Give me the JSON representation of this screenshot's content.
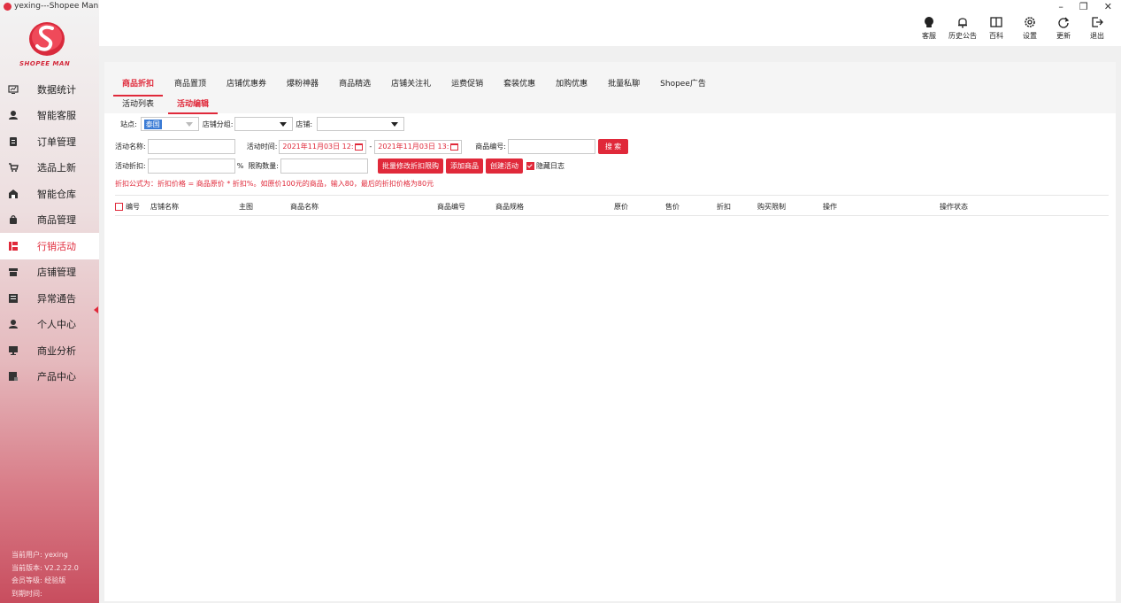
{
  "app": {
    "title": "yexing---Shopee Man",
    "logo_text": "SHOPEE MAN"
  },
  "window_controls": {
    "minimize": "–",
    "restore": "❐",
    "close": "✕"
  },
  "toolbar": [
    {
      "icon": "customer-service-icon",
      "label": "客服"
    },
    {
      "icon": "bell-icon",
      "label": "历史公告"
    },
    {
      "icon": "book-icon",
      "label": "百科"
    },
    {
      "icon": "gear-icon",
      "label": "设置"
    },
    {
      "icon": "refresh-icon",
      "label": "更新"
    },
    {
      "icon": "logout-icon",
      "label": "退出"
    }
  ],
  "sidebar": {
    "items": [
      {
        "icon": "chart-icon",
        "label": "数据统计"
      },
      {
        "icon": "service-icon",
        "label": "智能客服"
      },
      {
        "icon": "order-icon",
        "label": "订单管理"
      },
      {
        "icon": "cart-icon",
        "label": "选品上新"
      },
      {
        "icon": "warehouse-icon",
        "label": "智能仓库"
      },
      {
        "icon": "bag-icon",
        "label": "商品管理"
      },
      {
        "icon": "marketing-icon",
        "label": "行销活动",
        "active": true
      },
      {
        "icon": "store-icon",
        "label": "店铺管理"
      },
      {
        "icon": "alert-icon",
        "label": "异常通告"
      },
      {
        "icon": "user-icon",
        "label": "个人中心"
      },
      {
        "icon": "analysis-icon",
        "label": "商业分析"
      },
      {
        "icon": "product-icon",
        "label": "产品中心"
      }
    ],
    "user_info": {
      "user_label": "当前用户:",
      "user": "yexing",
      "version_label": "当前版本:",
      "version": "V2.2.22.0",
      "level_label": "会员等级:",
      "level": "经验版",
      "expire_label": "到期时间:",
      "expire": ""
    }
  },
  "tabs": [
    "商品折扣",
    "商品置顶",
    "店铺优惠券",
    "爆粉神器",
    "商品精选",
    "店铺关注礼",
    "运费促销",
    "套装优惠",
    "加购优惠",
    "批量私聊",
    "Shopee广告"
  ],
  "subtabs": [
    "活动列表",
    "活动编辑"
  ],
  "filters": {
    "site_label": "站点:",
    "site_value": "泰国",
    "group_label": "店铺分组:",
    "group_value": "",
    "shop_label": "店铺:",
    "shop_value": "",
    "name_label": "活动名称:",
    "name_value": "",
    "time_label": "活动时间:",
    "start": "2021年11月03日 12:",
    "end": "2021年11月03日 13:",
    "dash": "-",
    "code_label": "商品编号:",
    "code_value": "",
    "search_btn": "搜 索",
    "discount_label": "活动折扣:",
    "discount_value": "",
    "percent": "%",
    "limit_label": "限购数量:",
    "limit_value": "",
    "batch_btn": "批量修改折扣限购",
    "add_btn": "添加商品",
    "create_btn": "创建活动",
    "hide_log_label": "隐藏日志",
    "hide_log_checked": true,
    "formula": "折扣公式为：折扣价格 = 商品原价 * 折扣%。如原价100元的商品，输入80，最后的折扣价格为80元"
  },
  "table": {
    "columns": [
      "编号",
      "店铺名称",
      "主图",
      "商品名称",
      "商品编号",
      "商品规格",
      "原价",
      "售价",
      "折扣",
      "购买限制",
      "操作",
      "操作状态"
    ],
    "rows": []
  }
}
